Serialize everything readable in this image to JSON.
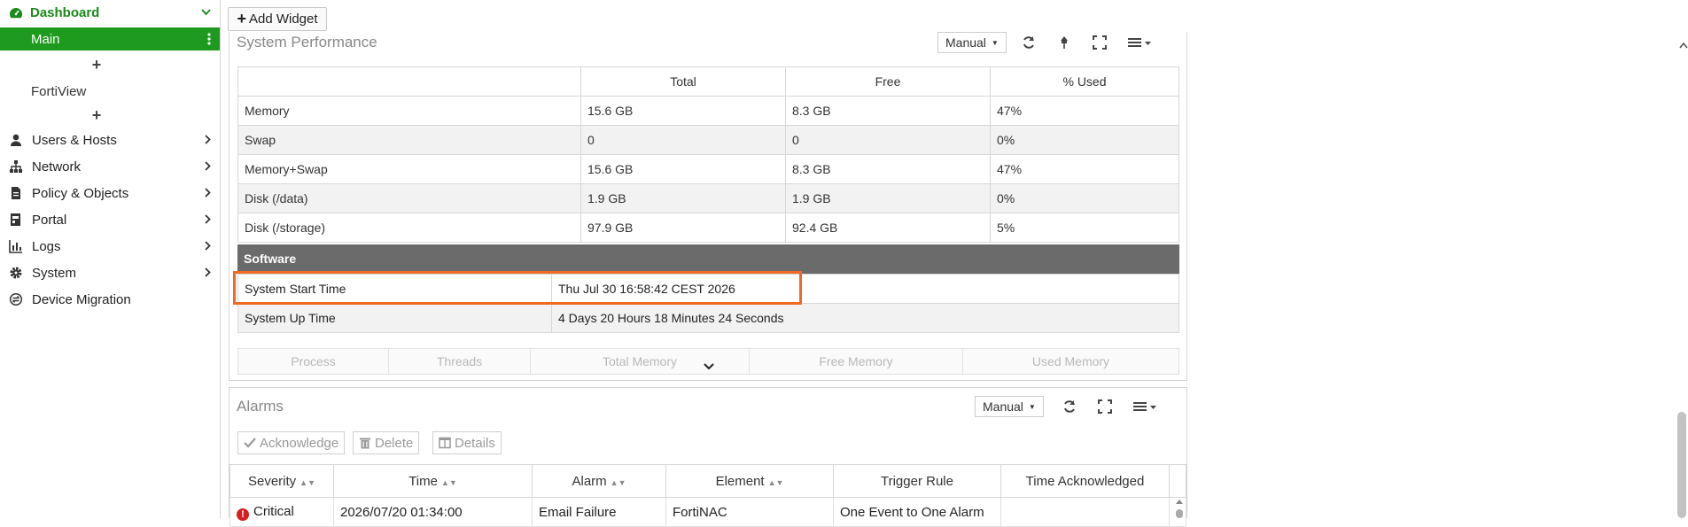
{
  "sidebar": {
    "dashboard_label": "Dashboard",
    "main_label": "Main",
    "plus": "+",
    "fortiview_label": "FortiView",
    "items": [
      {
        "label": "Users & Hosts",
        "icon": "user-icon",
        "has_chevron": true
      },
      {
        "label": "Network",
        "icon": "network-icon",
        "has_chevron": true
      },
      {
        "label": "Policy & Objects",
        "icon": "document-icon",
        "has_chevron": true
      },
      {
        "label": "Portal",
        "icon": "portal-icon",
        "has_chevron": true
      },
      {
        "label": "Logs",
        "icon": "chart-icon",
        "has_chevron": true
      },
      {
        "label": "System",
        "icon": "gear-icon",
        "has_chevron": true
      },
      {
        "label": "Device Migration",
        "icon": "migration-icon",
        "has_chevron": false
      }
    ]
  },
  "toolbar": {
    "add_widget_label": "Add Widget"
  },
  "performance": {
    "title": "System Performance",
    "refresh_mode": "Manual",
    "columns": [
      "",
      "Total",
      "Free",
      "% Used"
    ],
    "rows": [
      [
        "Memory",
        "15.6 GB",
        "8.3 GB",
        "47%"
      ],
      [
        "Swap",
        "0",
        "0",
        "0%"
      ],
      [
        "Memory+Swap",
        "15.6 GB",
        "8.3 GB",
        "47%"
      ],
      [
        "Disk (/data)",
        "1.9 GB",
        "1.9 GB",
        "0%"
      ],
      [
        "Disk (/storage)",
        "97.9 GB",
        "92.4 GB",
        "5%"
      ]
    ],
    "software_section": "Software",
    "software_rows": [
      [
        "System Start Time",
        "Thu Jul 30 16:58:42 CEST 2026"
      ],
      [
        "System Up Time",
        "4 Days 20 Hours 18 Minutes 24 Seconds"
      ]
    ],
    "process_columns": [
      "Process",
      "Threads",
      "Total Memory",
      "Free Memory",
      "Used Memory"
    ]
  },
  "alarms": {
    "title": "Alarms",
    "refresh_mode": "Manual",
    "buttons": {
      "acknowledge": "Acknowledge",
      "delete": "Delete",
      "details": "Details"
    },
    "columns": [
      "Severity",
      "Time",
      "Alarm",
      "Element",
      "Trigger Rule",
      "Time Acknowledged"
    ],
    "rows": [
      [
        "Critical",
        "2026/07/20 01:34:00",
        "Email Failure",
        "FortiNAC",
        "One Event to One Alarm",
        ""
      ]
    ]
  },
  "colors": {
    "brand_green": "#1e9a1e",
    "highlight": "#f26a21",
    "critical": "#d42020"
  }
}
